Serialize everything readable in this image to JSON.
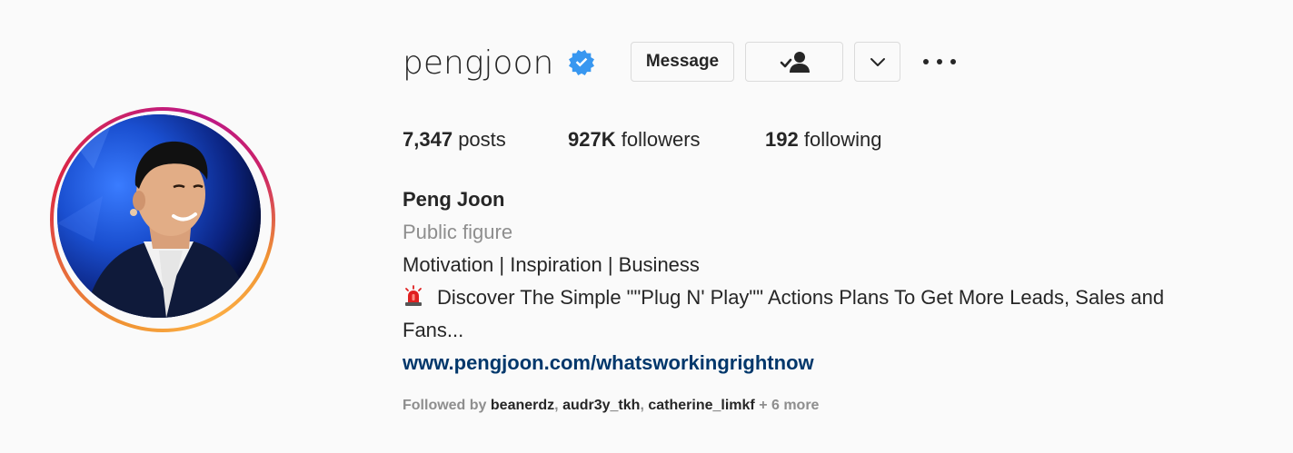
{
  "profile": {
    "username": "pengjoon",
    "verified": true,
    "avatar_icon": "profile-photo",
    "story_ring_colors": [
      "#f09433",
      "#dc2743",
      "#bc1888",
      "#fcaf45"
    ]
  },
  "actions": {
    "message_label": "Message",
    "following_icon": "person-check-icon",
    "dropdown_icon": "chevron-down-icon",
    "more_icon": "ellipsis-icon"
  },
  "stats": {
    "posts_count": "7,347",
    "posts_label": "posts",
    "followers_count": "927K",
    "followers_label": "followers",
    "following_count": "192",
    "following_label": "following"
  },
  "bio": {
    "full_name": "Peng Joon",
    "category": "Public figure",
    "line1": "Motivation | Inspiration | Business",
    "line2": "Discover The Simple \"\"Plug N' Play\"\" Actions Plans To Get More Leads, Sales and",
    "line3": "Fans...",
    "siren_icon": "siren-emoji",
    "website": "www.pengjoon.com/whatsworkingrightnow"
  },
  "followed_by": {
    "prefix": "Followed by",
    "users": [
      "beanerdz",
      "audr3y_tkh",
      "catherine_limkf"
    ],
    "sep": ",",
    "more": "+ 6 more"
  },
  "colors": {
    "verified_blue": "#3897f0",
    "link": "#00376b",
    "secondary_text": "#8e8e8e",
    "primary_text": "#262626"
  }
}
